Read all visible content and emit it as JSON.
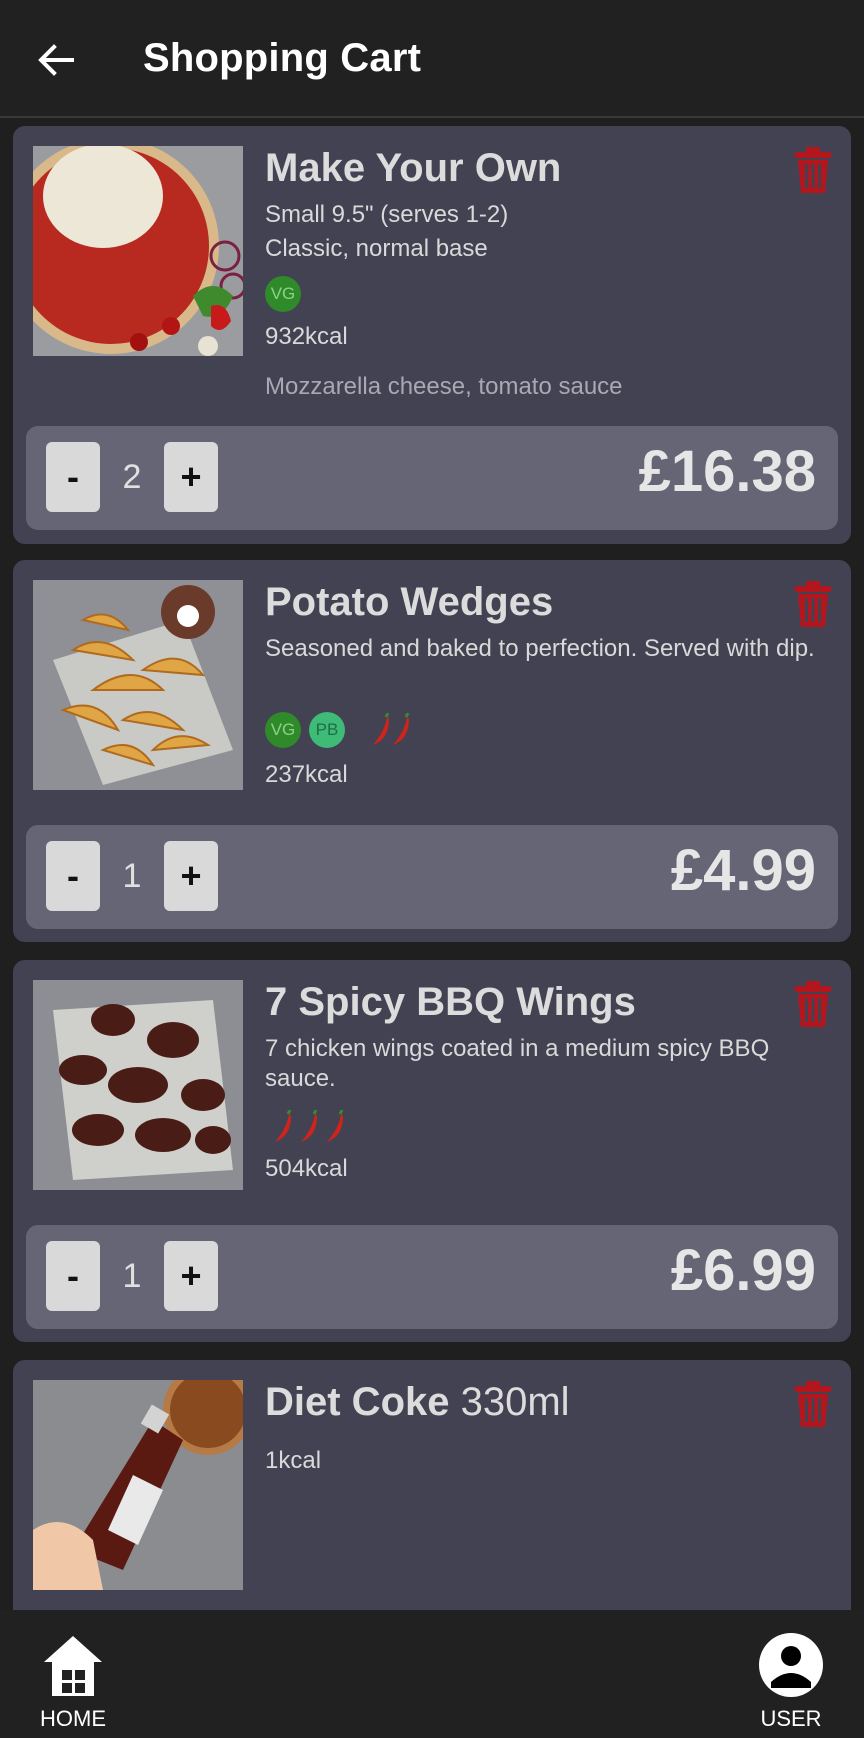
{
  "header": {
    "title": "Shopping Cart",
    "back_icon": "arrow-left-icon"
  },
  "colors": {
    "appbar": "#212121",
    "card": "#434252",
    "qty_bar": "#666575",
    "trash": "#b3161c",
    "vegan_badge": "#2f8a2a",
    "plant_based_badge": "#3dbb77"
  },
  "cart": {
    "items": [
      {
        "name": "Make Your Own",
        "size": "Small 9.5\" (serves 1-2)",
        "base": "Classic, normal base",
        "badges": [
          "VG"
        ],
        "kcal": "932kcal",
        "toppings": "Mozzarella cheese, tomato sauce",
        "quantity": "2",
        "price": "£16.38"
      },
      {
        "name": "Potato Wedges",
        "description": "Seasoned and baked to perfection. Served with dip.",
        "badges": [
          "VG",
          "PB"
        ],
        "spice_level": 2,
        "kcal": "237kcal",
        "quantity": "1",
        "price": "£4.99"
      },
      {
        "name": "7 Spicy BBQ Wings",
        "description": "7 chicken wings coated in a medium spicy BBQ sauce.",
        "spice_level": 3,
        "kcal": "504kcal",
        "quantity": "1",
        "price": "£6.99"
      },
      {
        "name": "Diet Coke",
        "name_suffix": "330ml",
        "kcal": "1kcal"
      }
    ],
    "qty_minus_label": "-",
    "qty_plus_label": "+"
  },
  "nav": {
    "home_label": "HOME",
    "user_label": "USER"
  }
}
